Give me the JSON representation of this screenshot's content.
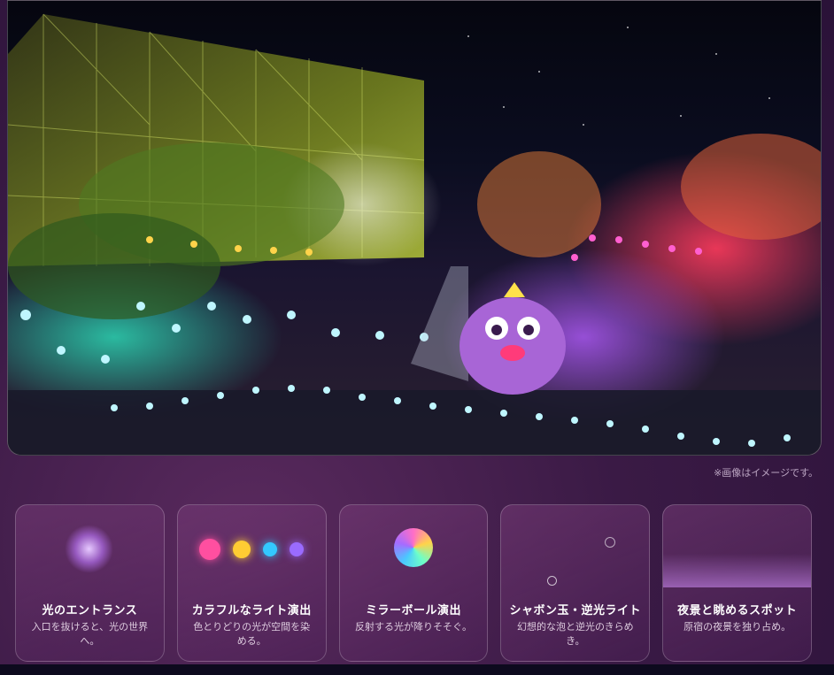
{
  "hero": {
    "caption": "※画像はイメージです。"
  },
  "cards": [
    {
      "title": "光のエントランス",
      "desc": "入口を抜けると、光の世界へ。"
    },
    {
      "title": "カラフルなライト演出",
      "desc": "色とりどりの光が空間を染める。"
    },
    {
      "title": "ミラーボール演出",
      "desc": "反射する光が降りそそぐ。"
    },
    {
      "title": "シャボン玉・逆光ライト",
      "desc": "幻想的な泡と逆光のきらめき。"
    },
    {
      "title": "夜景と眺めるスポット",
      "desc": "原宿の夜景を独り占め。"
    }
  ],
  "colors": {
    "dot1": "#ff4fa0",
    "dot2": "#ffcc33",
    "dot3": "#33c8ff",
    "dot4": "#9a6bff"
  }
}
